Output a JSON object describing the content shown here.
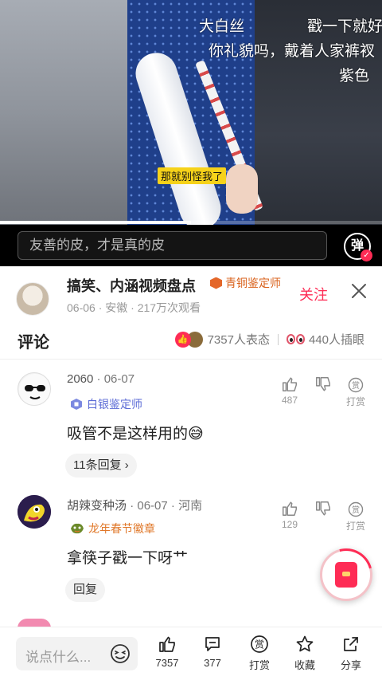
{
  "video": {
    "overlay_top_left": "大白丝",
    "overlay_top_right": "戳一下就好",
    "overlay_line2": "你礼貌吗，戴着人家裤衩",
    "overlay_line3": "紫色",
    "subtitle": "那就别怪我了",
    "progress_fraction": 0.5
  },
  "danmaku": {
    "placeholder": "友善的皮，才是真的皮",
    "toggle_label": "弹"
  },
  "author": {
    "name": "搞笑、内涵视频盘点",
    "badge": "青铜鉴定师",
    "meta": "06-06 · 安徽 · 217万次观看",
    "follow_label": "关注"
  },
  "comments_header": {
    "title": "评论",
    "reaction_count": "7357人表态",
    "eye_count": "440人插眼"
  },
  "comments": [
    {
      "user": "2060",
      "date": "06-07",
      "location": "",
      "tag": "白银鉴定师",
      "text": "吸管不是这样用的😅",
      "likes": "487",
      "tip_label": "打赏",
      "reply_label": "11条回复 ›"
    },
    {
      "user": "胡辣变种汤",
      "date": "06-07",
      "location": "河南",
      "tag": "龙年春节徽章",
      "text": "拿筷子戳一下呀艹",
      "likes": "129",
      "tip_label": "打赏",
      "reply_label": "回复"
    }
  ],
  "bottom_bar": {
    "input_placeholder": "说点什么...",
    "like_count": "7357",
    "comment_count": "377",
    "tip_label": "打赏",
    "favorite_label": "收藏",
    "share_label": "分享"
  },
  "colors": {
    "accent": "#fe2c55",
    "badge_bronze": "#d9611b",
    "badge_silver": "#5b6bd6",
    "badge_festival": "#e0782a"
  }
}
